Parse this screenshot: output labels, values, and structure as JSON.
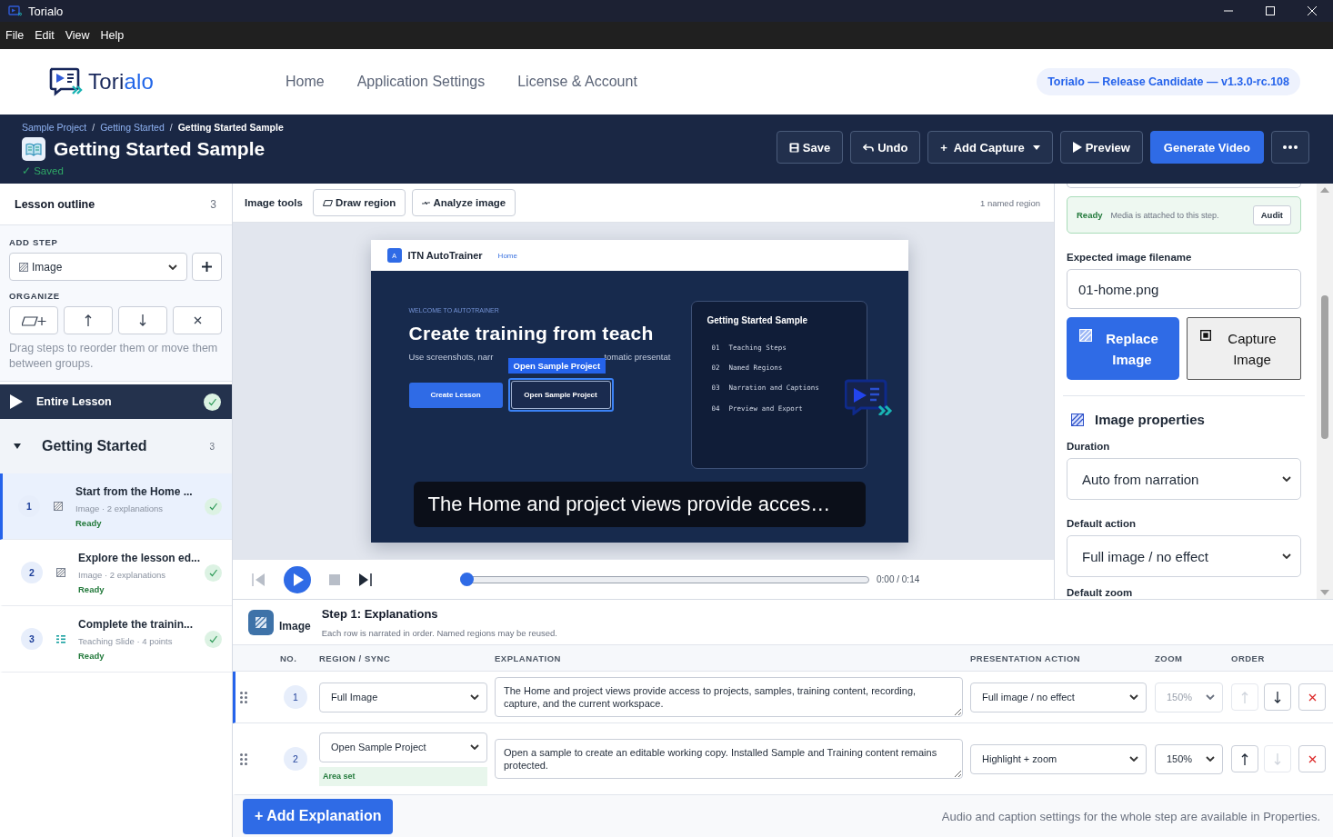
{
  "window": {
    "title": "Torialo"
  },
  "menu": [
    "File",
    "Edit",
    "View",
    "Help"
  ],
  "nav": {
    "logo": [
      "Tori",
      "alo"
    ],
    "links": [
      "Home",
      "Application Settings",
      "License & Account"
    ],
    "version": "Torialo — Release Candidate — v1.3.0-rc.108"
  },
  "project": {
    "breadcrumb": [
      {
        "kind": "link",
        "label": "Sample Project"
      },
      {
        "kind": "separator",
        "label": "/"
      },
      {
        "kind": "link",
        "label": "Getting Started"
      },
      {
        "kind": "separator",
        "label": "/"
      },
      {
        "kind": "current",
        "label": "Getting Started Sample"
      }
    ],
    "title": "Getting Started Sample",
    "saved": "✓ Saved",
    "actions": [
      {
        "kind": "save",
        "label": "Save"
      },
      {
        "kind": "undo",
        "label": "Undo"
      },
      {
        "kind": "dropdown",
        "label": "+  Add Capture"
      },
      {
        "kind": "play",
        "label": "Preview"
      },
      {
        "kind": "primary",
        "label": "Generate Video"
      },
      {
        "kind": "more"
      }
    ]
  },
  "sidebar": {
    "title": "Lesson outline",
    "count": "3",
    "add_step": {
      "label": "ADD STEP",
      "value": "Image"
    },
    "organize": {
      "label": "ORGANIZE",
      "buttons": [
        {
          "kind": "group"
        },
        {
          "kind": "up"
        },
        {
          "kind": "down"
        },
        {
          "kind": "remove"
        }
      ]
    },
    "hint": "Drag steps to reorder them or move them between groups.",
    "entire": {
      "label": "Entire Lesson",
      "complete": true
    },
    "groups": [
      {
        "title": "Getting Started",
        "count": "3",
        "expanded": true,
        "children": [
          {
            "number": "1",
            "kind": "image",
            "title": "Start from the Home ...",
            "meta": "Image · 2 explanations",
            "status": "Ready",
            "complete": true,
            "selected": true
          },
          {
            "number": "2",
            "kind": "image",
            "title": "Explore the lesson ed...",
            "meta": "Image · 2 explanations",
            "status": "Ready",
            "complete": true,
            "selected": false
          },
          {
            "number": "3",
            "kind": "slide",
            "title": "Complete the trainin...",
            "meta": "Teaching Slide · 4 points",
            "status": "Ready",
            "complete": true,
            "selected": false
          }
        ]
      }
    ]
  },
  "toolbar": {
    "title": "Image tools",
    "buttons": [
      {
        "kind": "region",
        "label": "Draw region"
      },
      {
        "kind": "analyze",
        "label": "Analyze image"
      }
    ],
    "info": "1 named region"
  },
  "preview": {
    "app": {
      "badge": "A",
      "name": "ITN AutoTrainer",
      "link": "Home",
      "eyebrow": "WELCOME TO AUTOTRAINER",
      "heading": "Create training from teach",
      "sub": [
        "Use screenshots, narr",
        "tomatic presentat"
      ],
      "buttons": [
        {
          "kind": "primary",
          "label": "Create Lesson",
          "highlighted": false
        },
        {
          "kind": "outline",
          "label": "Open Sample Project",
          "highlighted": true
        }
      ],
      "card": {
        "title": "Getting Started Sample",
        "items": [
          {
            "number": "01",
            "label": "Teaching Steps"
          },
          {
            "number": "02",
            "label": "Named Regions"
          },
          {
            "number": "03",
            "label": "Narration and Captions"
          },
          {
            "number": "04",
            "label": "Preview and Export"
          }
        ]
      }
    },
    "region_label": "Open Sample Project",
    "caption": "The Home and project views provide acces…"
  },
  "player": {
    "controls": [
      {
        "kind": "start",
        "disabled": true
      },
      {
        "kind": "play",
        "disabled": false
      },
      {
        "kind": "stop",
        "disabled": true
      },
      {
        "kind": "end",
        "disabled": false
      }
    ],
    "level": 0,
    "time": "0:00 / 0:14"
  },
  "properties": {
    "status": {
      "label": "Ready",
      "text": "Media is attached to this step.",
      "button": "Audit"
    },
    "filename": {
      "label": "Expected image filename",
      "value": "01-home.png"
    },
    "buttons": [
      {
        "kind": "primary",
        "label": "Replace Image"
      },
      {
        "kind": "secondary",
        "label": "Capture Image"
      }
    ],
    "section": "Image properties",
    "fields": [
      {
        "label": "Duration",
        "value": "Auto from narration"
      },
      {
        "label": "Default action",
        "value": "Full image / no effect"
      }
    ],
    "cut_label": "Default zoom"
  },
  "explanations": {
    "type_label": "Image",
    "title": "Step 1: Explanations",
    "subtitle": "Each row is narrated in order. Named regions may be reused.",
    "columns": [
      "NO.",
      "REGION / SYNC",
      "EXPLANATION",
      "PRESENTATION ACTION",
      "ZOOM",
      "ORDER"
    ],
    "rows": [
      {
        "number": "1",
        "selected": true,
        "region": "Full Image",
        "text": "The Home and project views provide access to projects, samples, training content, recording, capture, and the current workspace.",
        "action": "Full image / no effect",
        "zoom": {
          "value": "150%",
          "disabled": true
        },
        "order": [
          {
            "kind": "up",
            "disabled": true
          },
          {
            "kind": "down",
            "disabled": false
          },
          {
            "kind": "delete",
            "disabled": false
          }
        ]
      },
      {
        "number": "2",
        "selected": false,
        "region": "Open Sample Project",
        "badge": "Area set",
        "text": "Open a sample to create an editable working copy. Installed Sample and Training content remains protected.",
        "action": "Highlight + zoom",
        "zoom": {
          "value": "150%",
          "disabled": false
        },
        "order": [
          {
            "kind": "up",
            "disabled": false
          },
          {
            "kind": "down",
            "disabled": true
          },
          {
            "kind": "delete",
            "disabled": false
          }
        ]
      }
    ],
    "add_button": "+ Add Explanation",
    "note": "Audio and caption settings for the whole step are available in Properties."
  }
}
